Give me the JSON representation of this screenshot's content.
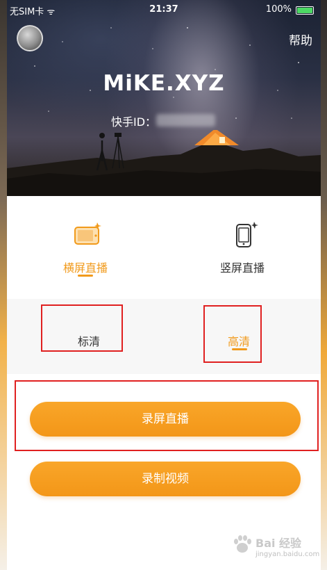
{
  "status_bar": {
    "carrier": "无SIM卡 ᯤ",
    "time": "21:37",
    "battery": "100%"
  },
  "header": {
    "help_label": "帮助",
    "username": "MiKE.XYZ",
    "id_label": "快手ID："
  },
  "modes": {
    "items": [
      {
        "label": "横屏直播",
        "icon": "landscape-phone-icon",
        "active": true
      },
      {
        "label": "竖屏直播",
        "icon": "portrait-phone-icon",
        "active": false
      }
    ]
  },
  "quality": {
    "standard_label": "标清",
    "hd_label": "高清",
    "selected": "高清"
  },
  "actions": {
    "record_screen_label": "录屏直播",
    "record_video_label": "录制视频"
  },
  "watermark": {
    "text": "Bai 经验",
    "sub": "jingyan.baidu.com"
  },
  "colors": {
    "accent": "#f19a1b",
    "highlight": "#e02020"
  }
}
